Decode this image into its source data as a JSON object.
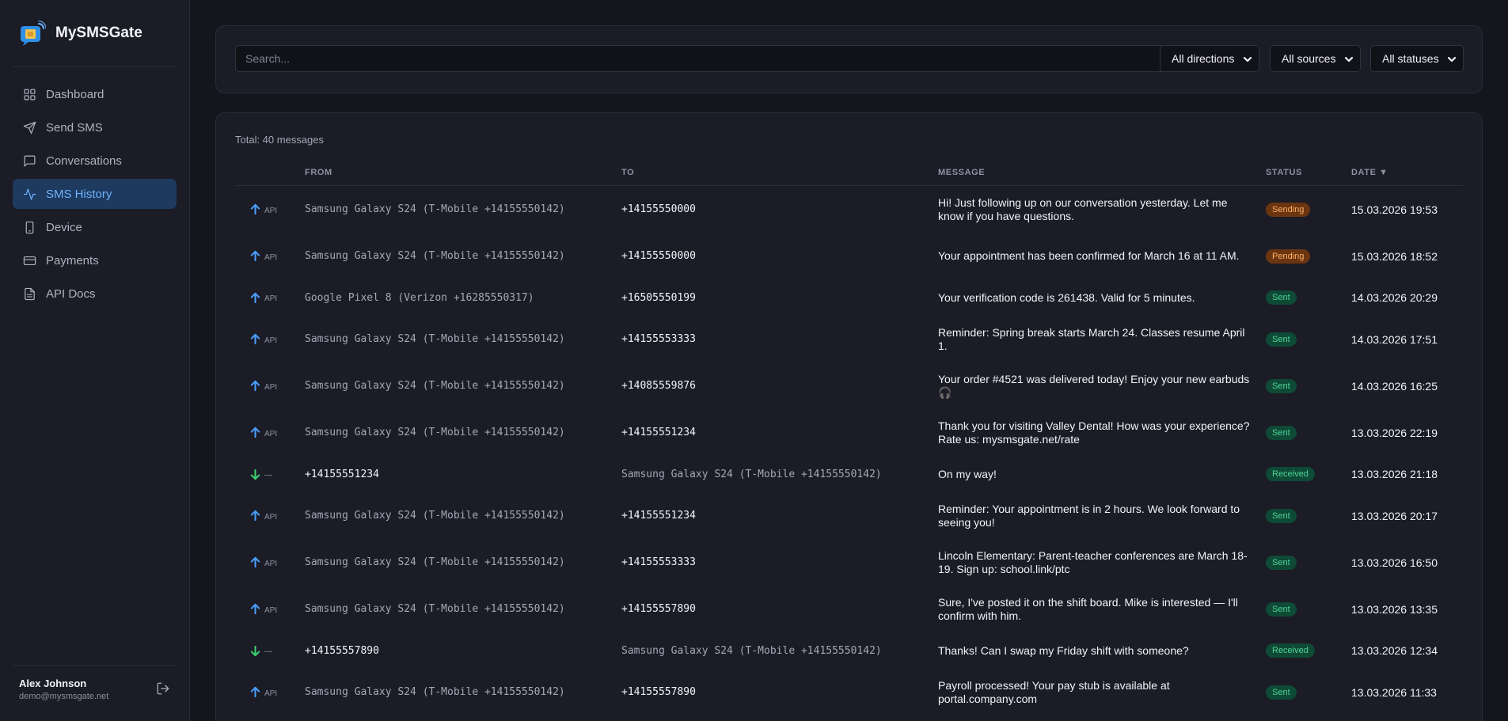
{
  "brand": {
    "name": "MySMSGate"
  },
  "nav": [
    {
      "label": "Dashboard",
      "icon": "grid-icon",
      "active": false
    },
    {
      "label": "Send SMS",
      "icon": "send-icon",
      "active": false
    },
    {
      "label": "Conversations",
      "icon": "chat-icon",
      "active": false
    },
    {
      "label": "SMS History",
      "icon": "activity-icon",
      "active": true
    },
    {
      "label": "Device",
      "icon": "phone-icon",
      "active": false
    },
    {
      "label": "Payments",
      "icon": "card-icon",
      "active": false
    },
    {
      "label": "API Docs",
      "icon": "document-icon",
      "active": false
    }
  ],
  "user": {
    "name": "Alex Johnson",
    "email": "demo@mysmsgate.net"
  },
  "filters": {
    "search_placeholder": "Search...",
    "direction": "All directions",
    "source": "All sources",
    "status": "All statuses"
  },
  "table": {
    "total": "Total: 40 messages",
    "headers": {
      "from": "FROM",
      "to": "TO",
      "message": "MESSAGE",
      "status": "STATUS",
      "date": "DATE ▼"
    },
    "rows": [
      {
        "dir": "out",
        "src": "API",
        "from": "Samsung Galaxy S24 (T-Mobile +14155550142)",
        "to": "+14155550000",
        "message": "Hi! Just following up on our conversation yesterday. Let me know if you have questions.",
        "status": "Sending",
        "status_kind": "sending",
        "date": "15.03.2026 19:53"
      },
      {
        "dir": "out",
        "src": "API",
        "from": "Samsung Galaxy S24 (T-Mobile +14155550142)",
        "to": "+14155550000",
        "message": "Your appointment has been confirmed for March 16 at 11 AM.",
        "status": "Pending",
        "status_kind": "pending",
        "date": "15.03.2026 18:52"
      },
      {
        "dir": "out",
        "src": "API",
        "from": "Google Pixel 8 (Verizon +16285550317)",
        "to": "+16505550199",
        "message": "Your verification code is 261438. Valid for 5 minutes.",
        "status": "Sent",
        "status_kind": "sent",
        "date": "14.03.2026 20:29"
      },
      {
        "dir": "out",
        "src": "API",
        "from": "Samsung Galaxy S24 (T-Mobile +14155550142)",
        "to": "+14155553333",
        "message": "Reminder: Spring break starts March 24. Classes resume April 1.",
        "status": "Sent",
        "status_kind": "sent",
        "date": "14.03.2026 17:51"
      },
      {
        "dir": "out",
        "src": "API",
        "from": "Samsung Galaxy S24 (T-Mobile +14155550142)",
        "to": "+14085559876",
        "message": "Your order #4521 was delivered today! Enjoy your new earbuds 🎧",
        "status": "Sent",
        "status_kind": "sent",
        "date": "14.03.2026 16:25"
      },
      {
        "dir": "out",
        "src": "API",
        "from": "Samsung Galaxy S24 (T-Mobile +14155550142)",
        "to": "+14155551234",
        "message": "Thank you for visiting Valley Dental! How was your experience? Rate us: mysmsgate.net/rate",
        "status": "Sent",
        "status_kind": "sent",
        "date": "13.03.2026 22:19"
      },
      {
        "dir": "in",
        "src": "—",
        "from": "+14155551234",
        "to": "Samsung Galaxy S24 (T-Mobile +14155550142)",
        "message": "On my way!",
        "status": "Received",
        "status_kind": "received",
        "date": "13.03.2026 21:18"
      },
      {
        "dir": "out",
        "src": "API",
        "from": "Samsung Galaxy S24 (T-Mobile +14155550142)",
        "to": "+14155551234",
        "message": "Reminder: Your appointment is in 2 hours. We look forward to seeing you!",
        "status": "Sent",
        "status_kind": "sent",
        "date": "13.03.2026 20:17"
      },
      {
        "dir": "out",
        "src": "API",
        "from": "Samsung Galaxy S24 (T-Mobile +14155550142)",
        "to": "+14155553333",
        "message": "Lincoln Elementary: Parent-teacher conferences are March 18-19. Sign up: school.link/ptc",
        "status": "Sent",
        "status_kind": "sent",
        "date": "13.03.2026 16:50"
      },
      {
        "dir": "out",
        "src": "API",
        "from": "Samsung Galaxy S24 (T-Mobile +14155550142)",
        "to": "+14155557890",
        "message": "Sure, I've posted it on the shift board. Mike is interested — I'll confirm with him.",
        "status": "Sent",
        "status_kind": "sent",
        "date": "13.03.2026 13:35"
      },
      {
        "dir": "in",
        "src": "—",
        "from": "+14155557890",
        "to": "Samsung Galaxy S24 (T-Mobile +14155550142)",
        "message": "Thanks! Can I swap my Friday shift with someone?",
        "status": "Received",
        "status_kind": "received",
        "date": "13.03.2026 12:34"
      },
      {
        "dir": "out",
        "src": "API",
        "from": "Samsung Galaxy S24 (T-Mobile +14155550142)",
        "to": "+14155557890",
        "message": "Payroll processed! Your pay stub is available at portal.company.com",
        "status": "Sent",
        "status_kind": "sent",
        "date": "13.03.2026 11:33"
      }
    ]
  }
}
